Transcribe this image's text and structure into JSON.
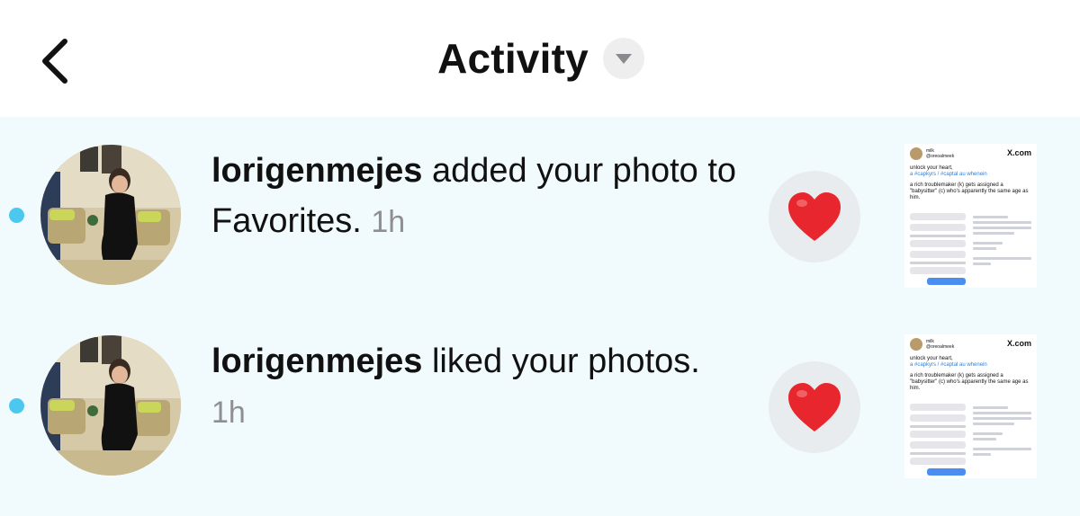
{
  "header": {
    "title": "Activity"
  },
  "colors": {
    "list_background": "#f1fbfd",
    "unread_dot": "#4cc8ee",
    "heart": "#e8262d",
    "timestamp": "#8e8e93"
  },
  "notifications": [
    {
      "username": "lorigenmejes",
      "action": " added your photo to Favorites.",
      "time": "1h",
      "unread": true,
      "reaction_icon": "heart-icon",
      "thumbnail": {
        "brand": "X.com",
        "line1": "unlock your heart,",
        "line2": "a #capkyrs / #captal au whenein",
        "line3": "a rich troublemaker (k) gets assigned a",
        "line4": "\"babysitter\" (c) who's apparently the same age as",
        "line5": "him."
      }
    },
    {
      "username": "lorigenmejes",
      "action": " liked your photos.",
      "time": "1h",
      "unread": true,
      "reaction_icon": "heart-icon",
      "thumbnail": {
        "brand": "X.com",
        "line1": "unlock your heart,",
        "line2": "a #capkyrs / #captal au whenein",
        "line3": "a rich troublemaker (k) gets assigned a",
        "line4": "\"babysitter\" (c) who's apparently the same age as",
        "line5": "him."
      }
    }
  ]
}
